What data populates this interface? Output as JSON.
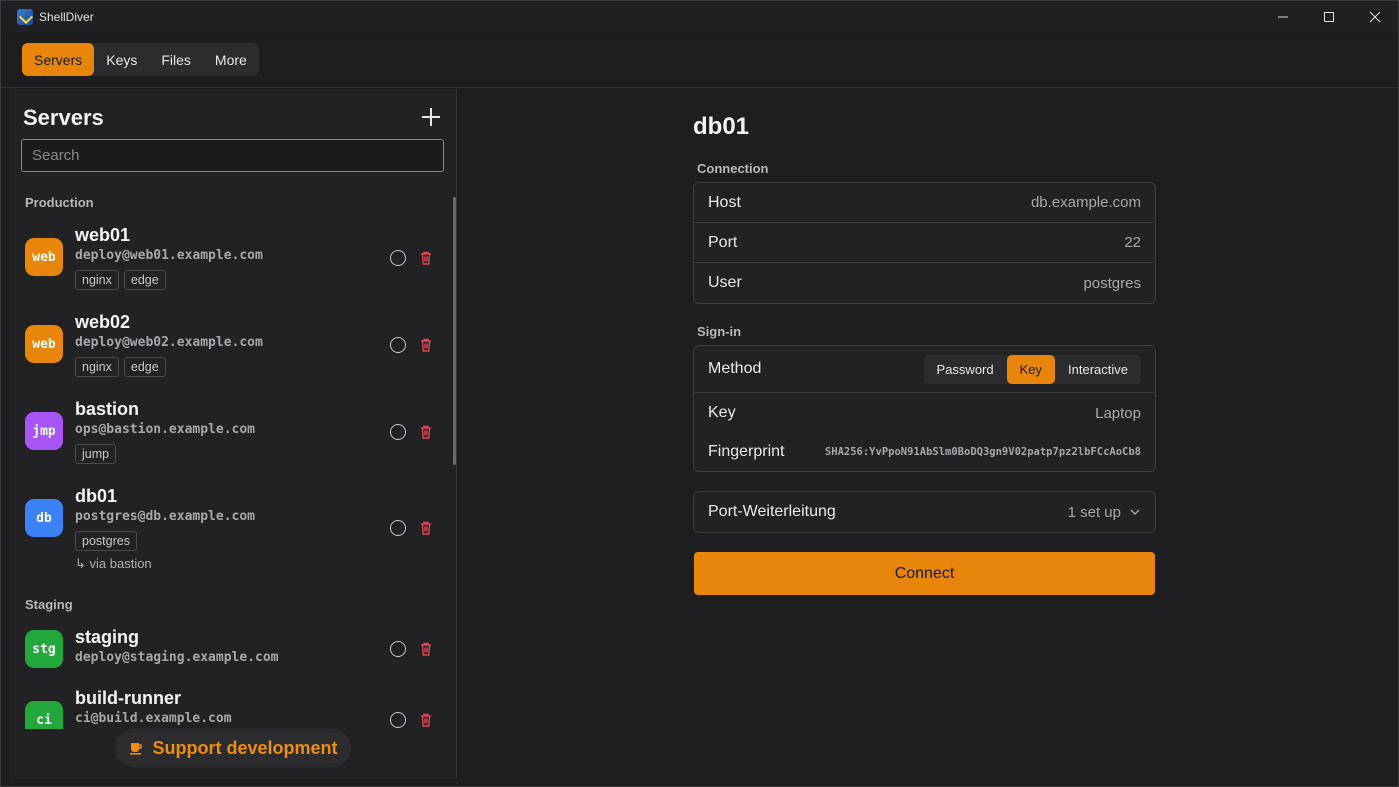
{
  "app": {
    "title": "ShellDiver"
  },
  "nav": {
    "tabs": [
      "Servers",
      "Keys",
      "Files",
      "More"
    ],
    "active": "Servers"
  },
  "sidebar": {
    "title": "Servers",
    "search_placeholder": "Search",
    "groups": [
      {
        "label": "Production"
      },
      {
        "label": "Staging"
      }
    ],
    "servers": [
      {
        "name": "web01",
        "address": "deploy@web01.example.com",
        "avatar": "web",
        "avatar_color": "#e8860c",
        "tags": [
          "nginx",
          "edge"
        ]
      },
      {
        "name": "web02",
        "address": "deploy@web02.example.com",
        "avatar": "web",
        "avatar_color": "#e8860c",
        "tags": [
          "nginx",
          "edge"
        ]
      },
      {
        "name": "bastion",
        "address": "ops@bastion.example.com",
        "avatar": "jmp",
        "avatar_color": "#a855f7",
        "tags": [
          "jump"
        ]
      },
      {
        "name": "db01",
        "address": "postgres@db.example.com",
        "avatar": "db",
        "avatar_color": "#3b82f6",
        "tags": [
          "postgres"
        ],
        "via": "via bastion"
      },
      {
        "name": "staging",
        "address": "deploy@staging.example.com",
        "avatar": "stg",
        "avatar_color": "#22a83a"
      },
      {
        "name": "build-runner",
        "address": "ci@build.example.com",
        "avatar": "ci",
        "avatar_color": "#22a83a"
      }
    ],
    "support_label": "Support development"
  },
  "detail": {
    "title": "db01",
    "connection_label": "Connection",
    "connection": [
      {
        "key": "Host",
        "value": "db.example.com"
      },
      {
        "key": "Port",
        "value": "22"
      },
      {
        "key": "User",
        "value": "postgres"
      }
    ],
    "signin_label": "Sign-in",
    "method_label": "Method",
    "methods": [
      "Password",
      "Key",
      "Interactive"
    ],
    "method_selected": "Key",
    "key_label": "Key",
    "key_value": "Laptop",
    "fingerprint_label": "Fingerprint",
    "fingerprint_value": "SHA256:YvPpoN91AbSlm0BoDQ3gn9V02patp7pz2lbFCcAoCb8",
    "forwarding_label": "Port-Weiterleitung",
    "forwarding_value": "1 set up",
    "connect_label": "Connect"
  },
  "colors": {
    "accent": "#e8860c",
    "danger": "#e0444e"
  }
}
